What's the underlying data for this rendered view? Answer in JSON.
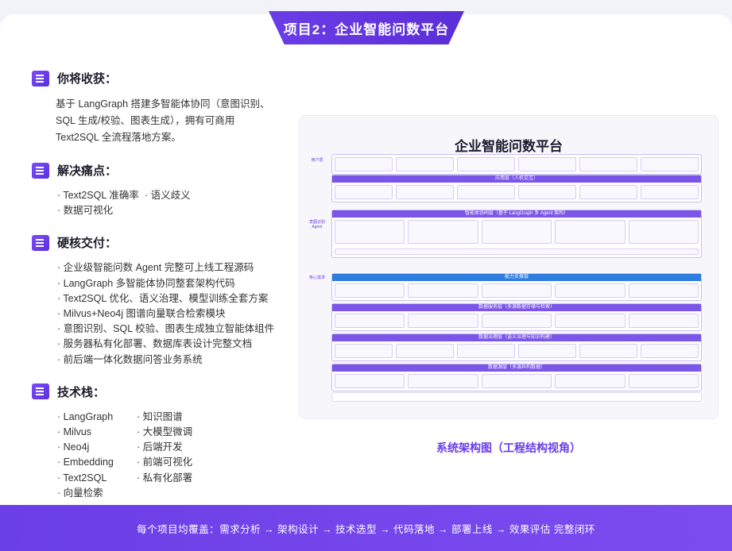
{
  "title": "项目2：企业智能问数平台",
  "sections": {
    "gain": {
      "title": "你将收获：",
      "text": "基于 LangGraph 搭建多智能体协同（意图识别、SQL 生成/校验、图表生成），拥有可商用 Text2SQL 全流程落地方案。"
    },
    "pain": {
      "title": "解决痛点：",
      "items": [
        "Text2SQL 准确率",
        "语义歧义",
        "数据可视化"
      ]
    },
    "deliver": {
      "title": "硬核交付：",
      "items": [
        "企业级智能问数 Agent 完整可上线工程源码",
        "LangGraph 多智能体协同整套架构代码",
        "Text2SQL 优化、语义治理、模型训练全套方案",
        "Milvus+Neo4j 图谱向量联合检索模块",
        "意图识别、SQL 校验、图表生成独立智能体组件",
        "服务器私有化部署、数据库表设计完整文档",
        "前后端一体化数据问答业务系统"
      ]
    },
    "stack": {
      "title": "技术栈：",
      "items": [
        "LangGraph",
        "知识图谱",
        "Milvus",
        "大模型微调",
        "Neo4j",
        "后端开发",
        "Embedding",
        "前端可视化",
        "Text2SQL",
        "私有化部署",
        "向量检索"
      ]
    }
  },
  "diagram": {
    "title": "企业智能问数平台",
    "layers": [
      "应用层（人机交互）",
      "智能体协同层（基于 LangGraph 多 Agent 架构）",
      "能力支撑层",
      "数据服务层（多源数据存储与检索）",
      "数据治理层（语义治理与知识构建）",
      "数据源层（多源异构数据）"
    ],
    "side_labels": [
      "用户层",
      "意图识别 Agent",
      "核心需求"
    ],
    "caption": "系统架构图（工程结构视角）"
  },
  "footer": "每个项目均覆盖：需求分析 → 架构设计 → 技术选型 → 代码落地 → 部署上线 → 效果评估 完整闭环"
}
